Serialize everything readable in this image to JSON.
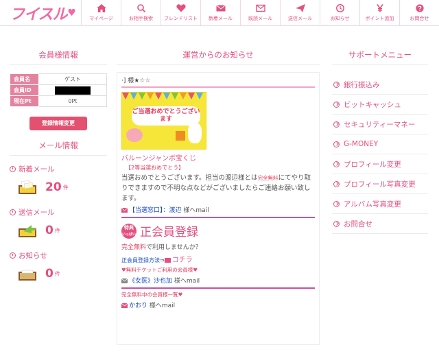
{
  "header": {
    "logo": "フイスル",
    "nav": [
      {
        "label": "マイページ",
        "icon": "home-icon"
      },
      {
        "label": "お相手検索",
        "icon": "search-icon"
      },
      {
        "label": "フレンドリスト",
        "icon": "heart-icon"
      },
      {
        "label": "新着メール",
        "icon": "mail-icon"
      },
      {
        "label": "既読メール",
        "icon": "mail-open-icon"
      },
      {
        "label": "送信メール",
        "icon": "send-icon"
      },
      {
        "label": "お知らせ",
        "icon": "clock-icon"
      },
      {
        "label": "ポイント追加",
        "icon": "yen-icon"
      },
      {
        "label": "お問合せ",
        "icon": "question-icon"
      }
    ]
  },
  "left": {
    "member_title": "会員様情報",
    "rows": [
      {
        "key": "会員名",
        "value": "ゲスト"
      },
      {
        "key": "会員ID",
        "value": ""
      },
      {
        "key": "現在Pt",
        "value": "0Pt"
      }
    ],
    "register_button": "登録情報変更",
    "mail_title": "メール情報",
    "mail_groups": [
      {
        "label": "新着メール",
        "count": "20",
        "unit": "件"
      },
      {
        "label": "送信メール",
        "count": "0",
        "unit": "件"
      },
      {
        "label": "お知らせ",
        "count": "0",
        "unit": "件"
      }
    ]
  },
  "middle": {
    "title": "運営からのお知らせ",
    "head": "·] 様★☆☆",
    "banner_text": "ご当選おめでとうございます",
    "lottery_title": "バルーンジャンボ宝くじ",
    "lottery_sub": "【2等当選おめでとう】",
    "body_part1": "当選おめでとうございます。担当の渡辺様とは",
    "body_red": "完全無料",
    "body_part2": "にてやり取りできますので不明な点などがございましたらご連絡お願い致します。",
    "sender1_link": "【当選窓口】：渡辺",
    "sender1_suffix": " 様へmail",
    "badge_top": "特典",
    "badge_bottom": "いっぱい",
    "reg_title": "正会員登録",
    "free_red": "完全無料",
    "free_rest": "で利用しませんか？",
    "how_label": "正会員登録方法⇒",
    "how_link": "コチラ",
    "ticket": "無料チケットご利用の会員様",
    "sender2_link": "《女医》沙也加",
    "sender2_suffix": " 様へmail",
    "free_members": "完全無料中の会員様一覧",
    "sender3_link": "かおり",
    "sender3_suffix": " 様へmail"
  },
  "right": {
    "title": "サポートメニュー",
    "items": [
      "銀行振込み",
      "ビットキャッシュ",
      "セキュリティーマネー",
      "G-MONEY",
      "プロフィール変更",
      "プロフィール写真変更",
      "アルバム写真変更",
      "お問合せ"
    ]
  }
}
